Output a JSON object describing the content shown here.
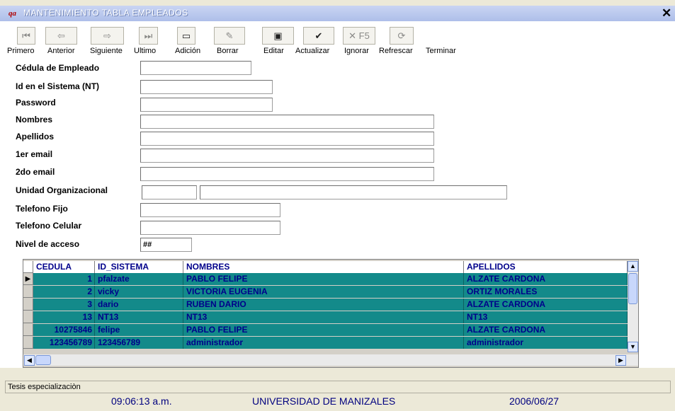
{
  "window": {
    "app_icon": "qa",
    "title": "MANTENIMIENTO TABLA EMPLEADOS",
    "close_glyph": "✕"
  },
  "toolbar": {
    "buttons": [
      {
        "icon": "first-record-icon",
        "glyph": "⏮",
        "label": "Primero"
      },
      {
        "icon": "previous-record-icon",
        "glyph": "⇦",
        "label": "Anterior"
      },
      {
        "icon": "next-record-icon",
        "glyph": "⇨",
        "label": "Siguiente"
      },
      {
        "icon": "last-record-icon",
        "glyph": "⏭",
        "label": "Ultimo"
      },
      {
        "icon": "add-icon",
        "glyph": "▭",
        "label": "Adición"
      },
      {
        "icon": "erase-icon",
        "glyph": "✎",
        "label": "Borrar"
      },
      {
        "icon": "edit-icon",
        "glyph": "▣",
        "label": "Editar"
      },
      {
        "icon": "checkmark-icon",
        "glyph": "✔",
        "label": "Actualizar"
      },
      {
        "icon": "ignore-f5-icon",
        "glyph": "✕ F5",
        "label": "Ignorar"
      },
      {
        "icon": "refresh-icon",
        "glyph": "⟳",
        "label": "Refrescar"
      },
      {
        "label": "Terminar"
      }
    ]
  },
  "form": {
    "cedula_label": "Cédula de Empleado",
    "cedula_value": "",
    "id_sistema_label": "Id en el Sistema (NT)",
    "id_sistema_value": "",
    "password_label": "Password",
    "password_value": "",
    "nombres_label": "Nombres",
    "nombres_value": "",
    "apellidos_label": "Apellidos",
    "apellidos_value": "",
    "email1_label": "1er email",
    "email1_value": "",
    "email2_label": "2do email",
    "email2_value": "",
    "unidad_label": "Unidad Organizacional",
    "unidad_code": "",
    "unidad_name": "",
    "tel_fijo_label": "Telefono Fijo",
    "tel_fijo_value": "",
    "tel_celular_label": "Telefono Celular",
    "tel_celular_value": "",
    "nivel_label": "Nivel de acceso",
    "nivel_value": "##"
  },
  "grid": {
    "columns": [
      "CEDULA",
      "ID_SISTEMA",
      "NOMBRES",
      "APELLIDOS"
    ],
    "rows": [
      {
        "cedula": "1",
        "id_sistema": "pfalzate",
        "nombres": "PABLO FELIPE",
        "apellidos": "ALZATE CARDONA"
      },
      {
        "cedula": "2",
        "id_sistema": "vicky",
        "nombres": "VICTORIA EUGENIA",
        "apellidos": "ORTIZ MORALES"
      },
      {
        "cedula": "3",
        "id_sistema": "dario",
        "nombres": "RUBEN DARIO",
        "apellidos": "ALZATE CARDONA"
      },
      {
        "cedula": "13",
        "id_sistema": "NT13",
        "nombres": "NT13",
        "apellidos": "NT13"
      },
      {
        "cedula": "10275846",
        "id_sistema": "felipe",
        "nombres": "PABLO FELIPE",
        "apellidos": "ALZATE CARDONA"
      },
      {
        "cedula": "123456789",
        "id_sistema": "123456789",
        "nombres": "administrador",
        "apellidos": "administrador"
      }
    ],
    "current_row_marker": "▶",
    "row_color": "#138a8a",
    "text_color": "#00008b"
  },
  "status": {
    "message": "Tesis especializaciòn",
    "time": "09:06:13 a.m.",
    "institution": "UNIVERSIDAD DE MANIZALES",
    "date": "2006/06/27"
  }
}
